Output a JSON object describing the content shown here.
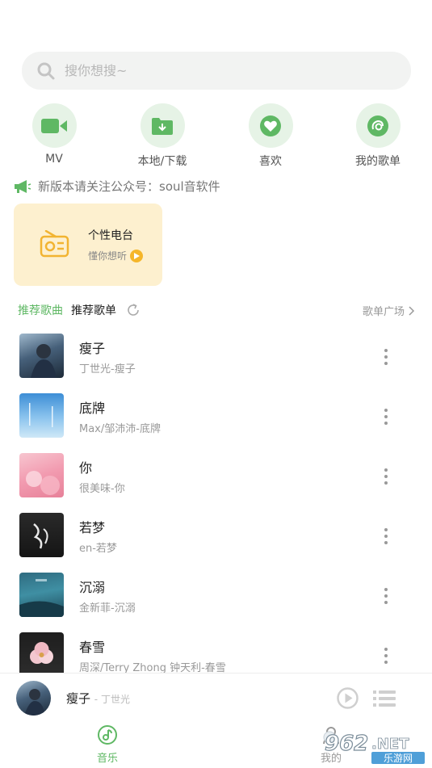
{
  "search": {
    "placeholder": "搜你想搜~"
  },
  "quick_actions": [
    {
      "label": "MV",
      "icon": "video-icon"
    },
    {
      "label": "本地/下载",
      "icon": "download-folder-icon"
    },
    {
      "label": "喜欢",
      "icon": "heart-icon"
    },
    {
      "label": "我的歌单",
      "icon": "playlist-icon"
    }
  ],
  "notice": {
    "text": "新版本请关注公众号：soul音软件"
  },
  "radio": {
    "title": "个性电台",
    "subtitle": "懂你想听"
  },
  "tabs": {
    "recommended_songs": "推荐歌曲",
    "recommended_playlists": "推荐歌单",
    "plaza": "歌单广场"
  },
  "songs": [
    {
      "title": "瘦子",
      "subtitle": "丁世光-瘦子"
    },
    {
      "title": "底牌",
      "subtitle": "Max/邹沛沛-底牌"
    },
    {
      "title": "你",
      "subtitle": "很美味-你"
    },
    {
      "title": "若梦",
      "subtitle": "en-若梦"
    },
    {
      "title": "沉溺",
      "subtitle": "金新菲-沉溺"
    },
    {
      "title": "春雪",
      "subtitle": "周深/Terry Zhong 钟天利-春雪"
    }
  ],
  "player": {
    "title": "瘦子",
    "artist": "- 丁世光"
  },
  "nav": {
    "music": "音乐",
    "mine": "我的"
  },
  "colors": {
    "accent": "#5fb864",
    "radio_bg": "#fdf0cf",
    "quick_bg": "#e6f3e6"
  },
  "watermark": {
    "text": "962.NET",
    "subtext": "乐游网"
  }
}
